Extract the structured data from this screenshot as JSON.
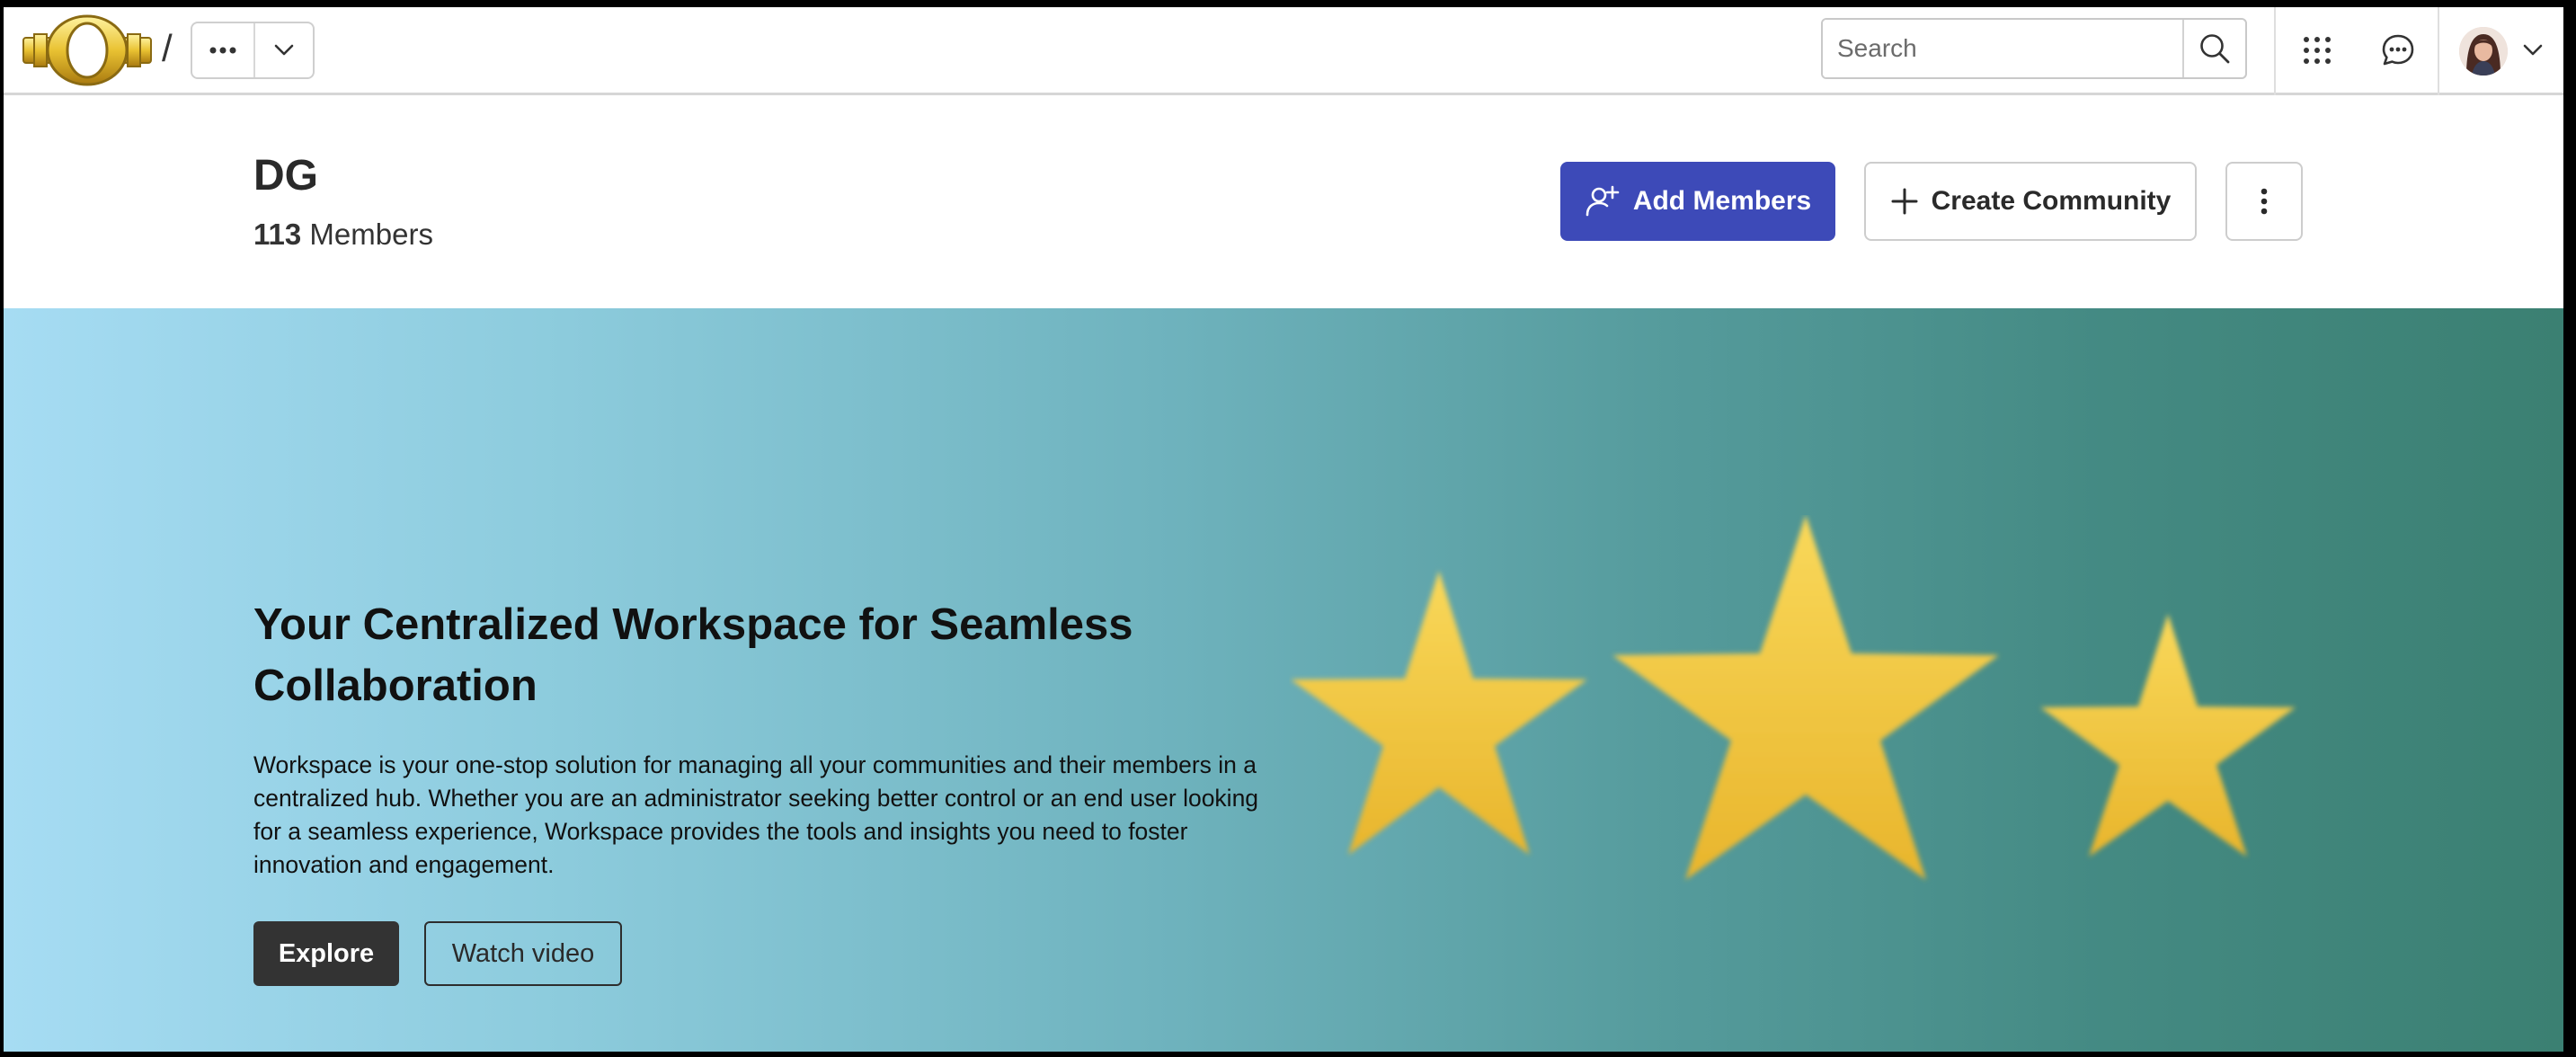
{
  "topbar": {
    "breadcrumb_separator": "/",
    "search_placeholder": "Search"
  },
  "header": {
    "title": "DG",
    "member_count": "113",
    "member_label": "Members",
    "add_members_label": "Add Members",
    "create_community_label": "Create Community"
  },
  "hero": {
    "title": "Your Centralized Workspace for Seamless Collaboration",
    "description": "Workspace is your one-stop solution for managing all your communities and their members in a centralized hub. Whether you are an administrator seeking better control or an end user looking for a seamless experience, Workspace provides the tools and insights you need to foster innovation and engagement.",
    "explore_label": "Explore",
    "watch_video_label": "Watch video"
  },
  "colors": {
    "primary": "#3d4ab8",
    "hero_gradient_start": "#a6dcf3",
    "hero_gradient_end": "#3b8072",
    "star": "#f2c53d"
  },
  "icons": [
    "logo-emblem",
    "more-horizontal-icon",
    "chevron-down-icon",
    "search-icon",
    "apps-grid-icon",
    "chat-icon",
    "avatar",
    "add-user-icon",
    "plus-icon",
    "kebab-icon",
    "star-icon"
  ]
}
